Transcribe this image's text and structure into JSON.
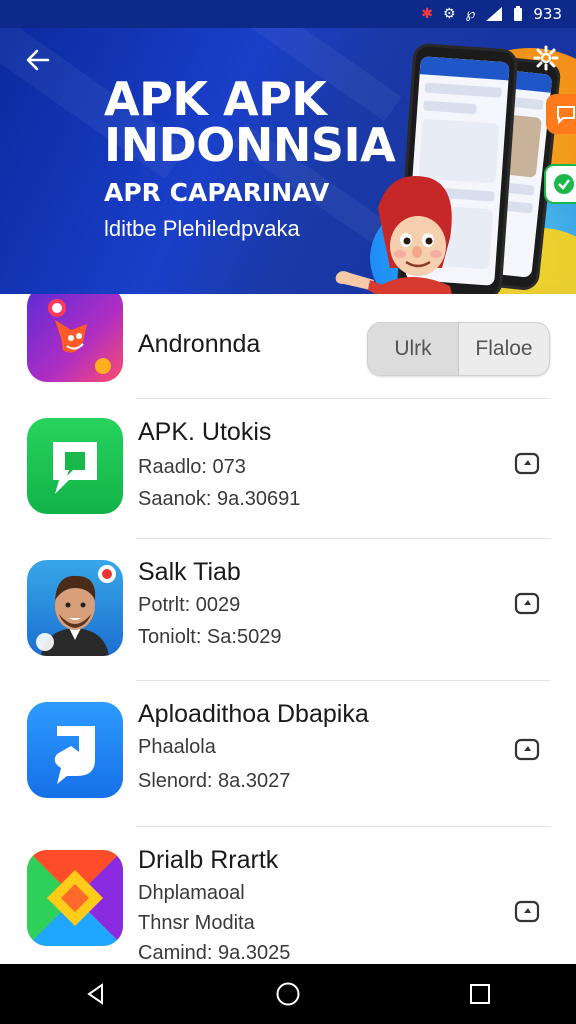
{
  "status_bar": {
    "icons": [
      "notification-alert-icon",
      "settings-sync-icon",
      "loop-icon",
      "signal-icon",
      "battery-icon"
    ],
    "battery_text": "933"
  },
  "banner": {
    "title": "APK APK INDONNSIA",
    "subtitle": "APR CAPARINAV",
    "tagline": "lditbe Plehiledpvaka",
    "colors": {
      "bg": "#1a3fc9",
      "accent_orange": "#ff7a00",
      "accent_yellow": "#ffd21a",
      "accent_cyan": "#3fd0ff"
    }
  },
  "header_item": {
    "name": "Andronnda",
    "segment": {
      "left": "Ulrk",
      "right": "Flaloe"
    }
  },
  "apps": [
    {
      "name": "APK. Utokis",
      "meta1": "Raadlo: 073",
      "meta2": "Saanok: 9a.30691",
      "icon": "chat-bubble-icon"
    },
    {
      "name": "Salk Tiab",
      "meta1": "Potrlt:  0029",
      "meta2": "Toniolt: Sa:5029",
      "icon": "avatar-icon"
    },
    {
      "name": "Aploadithoa Dbapika",
      "meta1": "Phaalola",
      "meta2": "Slenord: 8a.3027",
      "icon": "share-arrow-icon"
    },
    {
      "name": "Drialb Rrartk",
      "meta1": "Dhplamaoal",
      "meta2": "Thnsr Modita",
      "meta3": "Camind: 9a.3025",
      "icon": "geometric-logo-icon"
    }
  ],
  "nav": {
    "back": "back-icon",
    "home": "home-icon",
    "recents": "recents-icon"
  }
}
